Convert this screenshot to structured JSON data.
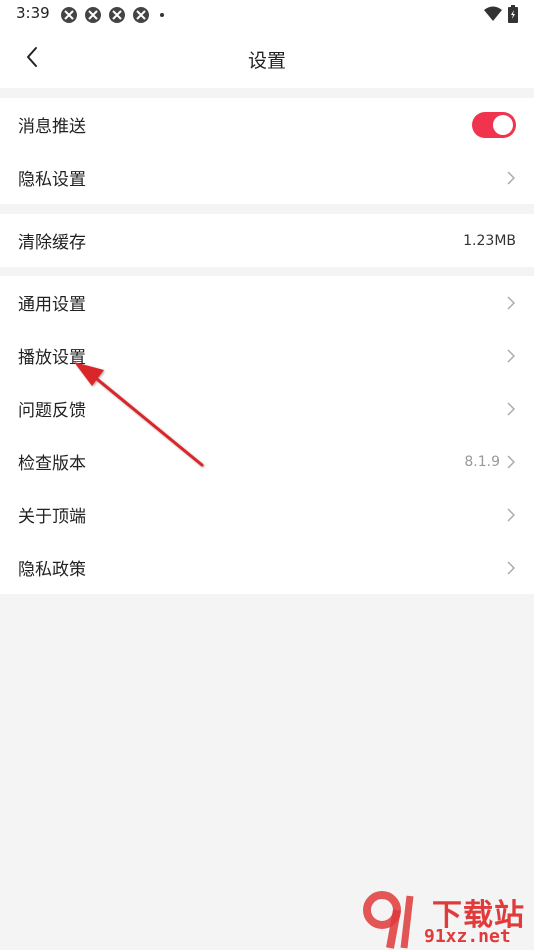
{
  "status_bar": {
    "time": "3:39",
    "app_icons": [
      "app-notification-icon",
      "app-notification-icon",
      "app-notification-icon",
      "app-notification-icon"
    ],
    "wifi_icon": "wifi-icon",
    "battery_icon": "battery-icon"
  },
  "header": {
    "title": "设置",
    "back_icon": "chevron-left-icon"
  },
  "groups": [
    {
      "items": [
        {
          "label": "消息推送",
          "control": "toggle",
          "toggle_on": true
        },
        {
          "label": "隐私设置",
          "control": "chevron"
        }
      ]
    },
    {
      "items": [
        {
          "label": "清除缓存",
          "control": "value",
          "value": "1.23MB"
        }
      ]
    },
    {
      "items": [
        {
          "label": "通用设置",
          "control": "chevron"
        },
        {
          "label": "播放设置",
          "control": "chevron"
        },
        {
          "label": "问题反馈",
          "control": "chevron"
        },
        {
          "label": "检查版本",
          "control": "value-chevron",
          "value": "8.1.9"
        },
        {
          "label": "关于顶端",
          "control": "chevron"
        },
        {
          "label": "隐私政策",
          "control": "chevron"
        }
      ]
    }
  ],
  "colors": {
    "accent": "#f0344e",
    "annotation_arrow": "#d9262b",
    "background": "#f4f4f4"
  },
  "watermark": {
    "text_top": "下载站",
    "text_bottom": "91xz.net"
  }
}
